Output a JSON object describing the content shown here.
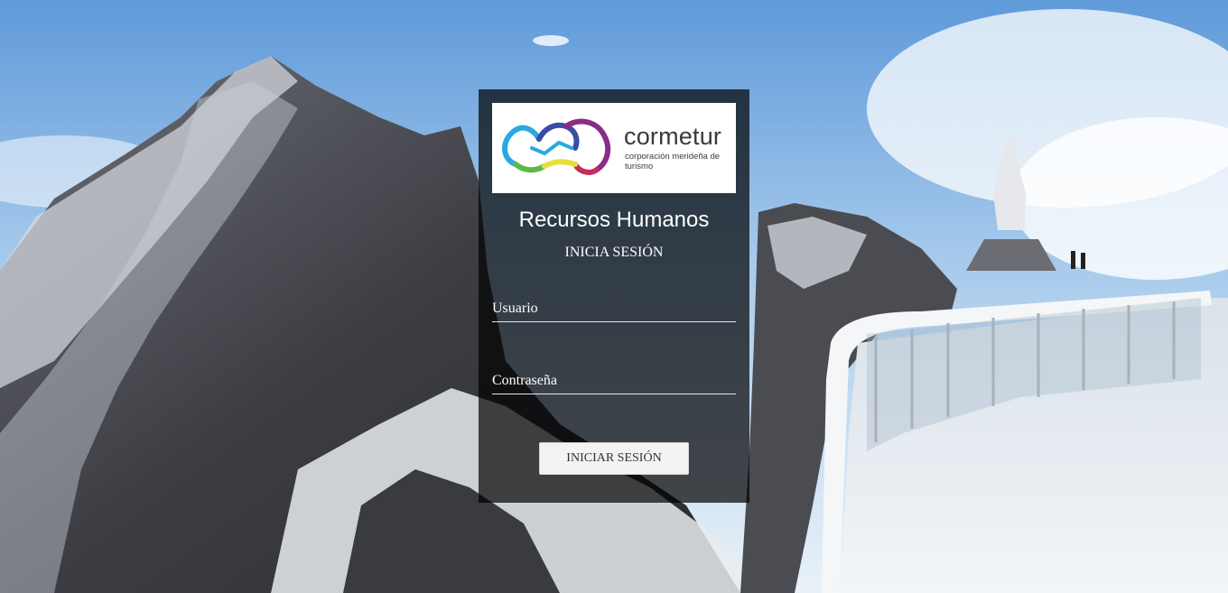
{
  "brand": {
    "name": "cormetur",
    "tagline": "corporación merideña de turismo",
    "logo_colors": [
      "#29a9e0",
      "#3b4ba8",
      "#8a2c86",
      "#c72c5b",
      "#e6e03a",
      "#5bb947"
    ]
  },
  "login": {
    "app_title": "Recursos Humanos",
    "subtitle": "INICIA SESIÓN",
    "username_placeholder": "Usuario",
    "password_placeholder": "Contraseña",
    "submit_label": "INICIAR SESIÓN"
  },
  "colors": {
    "card_overlay": "#000000",
    "button_bg": "#f3f3f3",
    "text_light": "#ffffff"
  }
}
